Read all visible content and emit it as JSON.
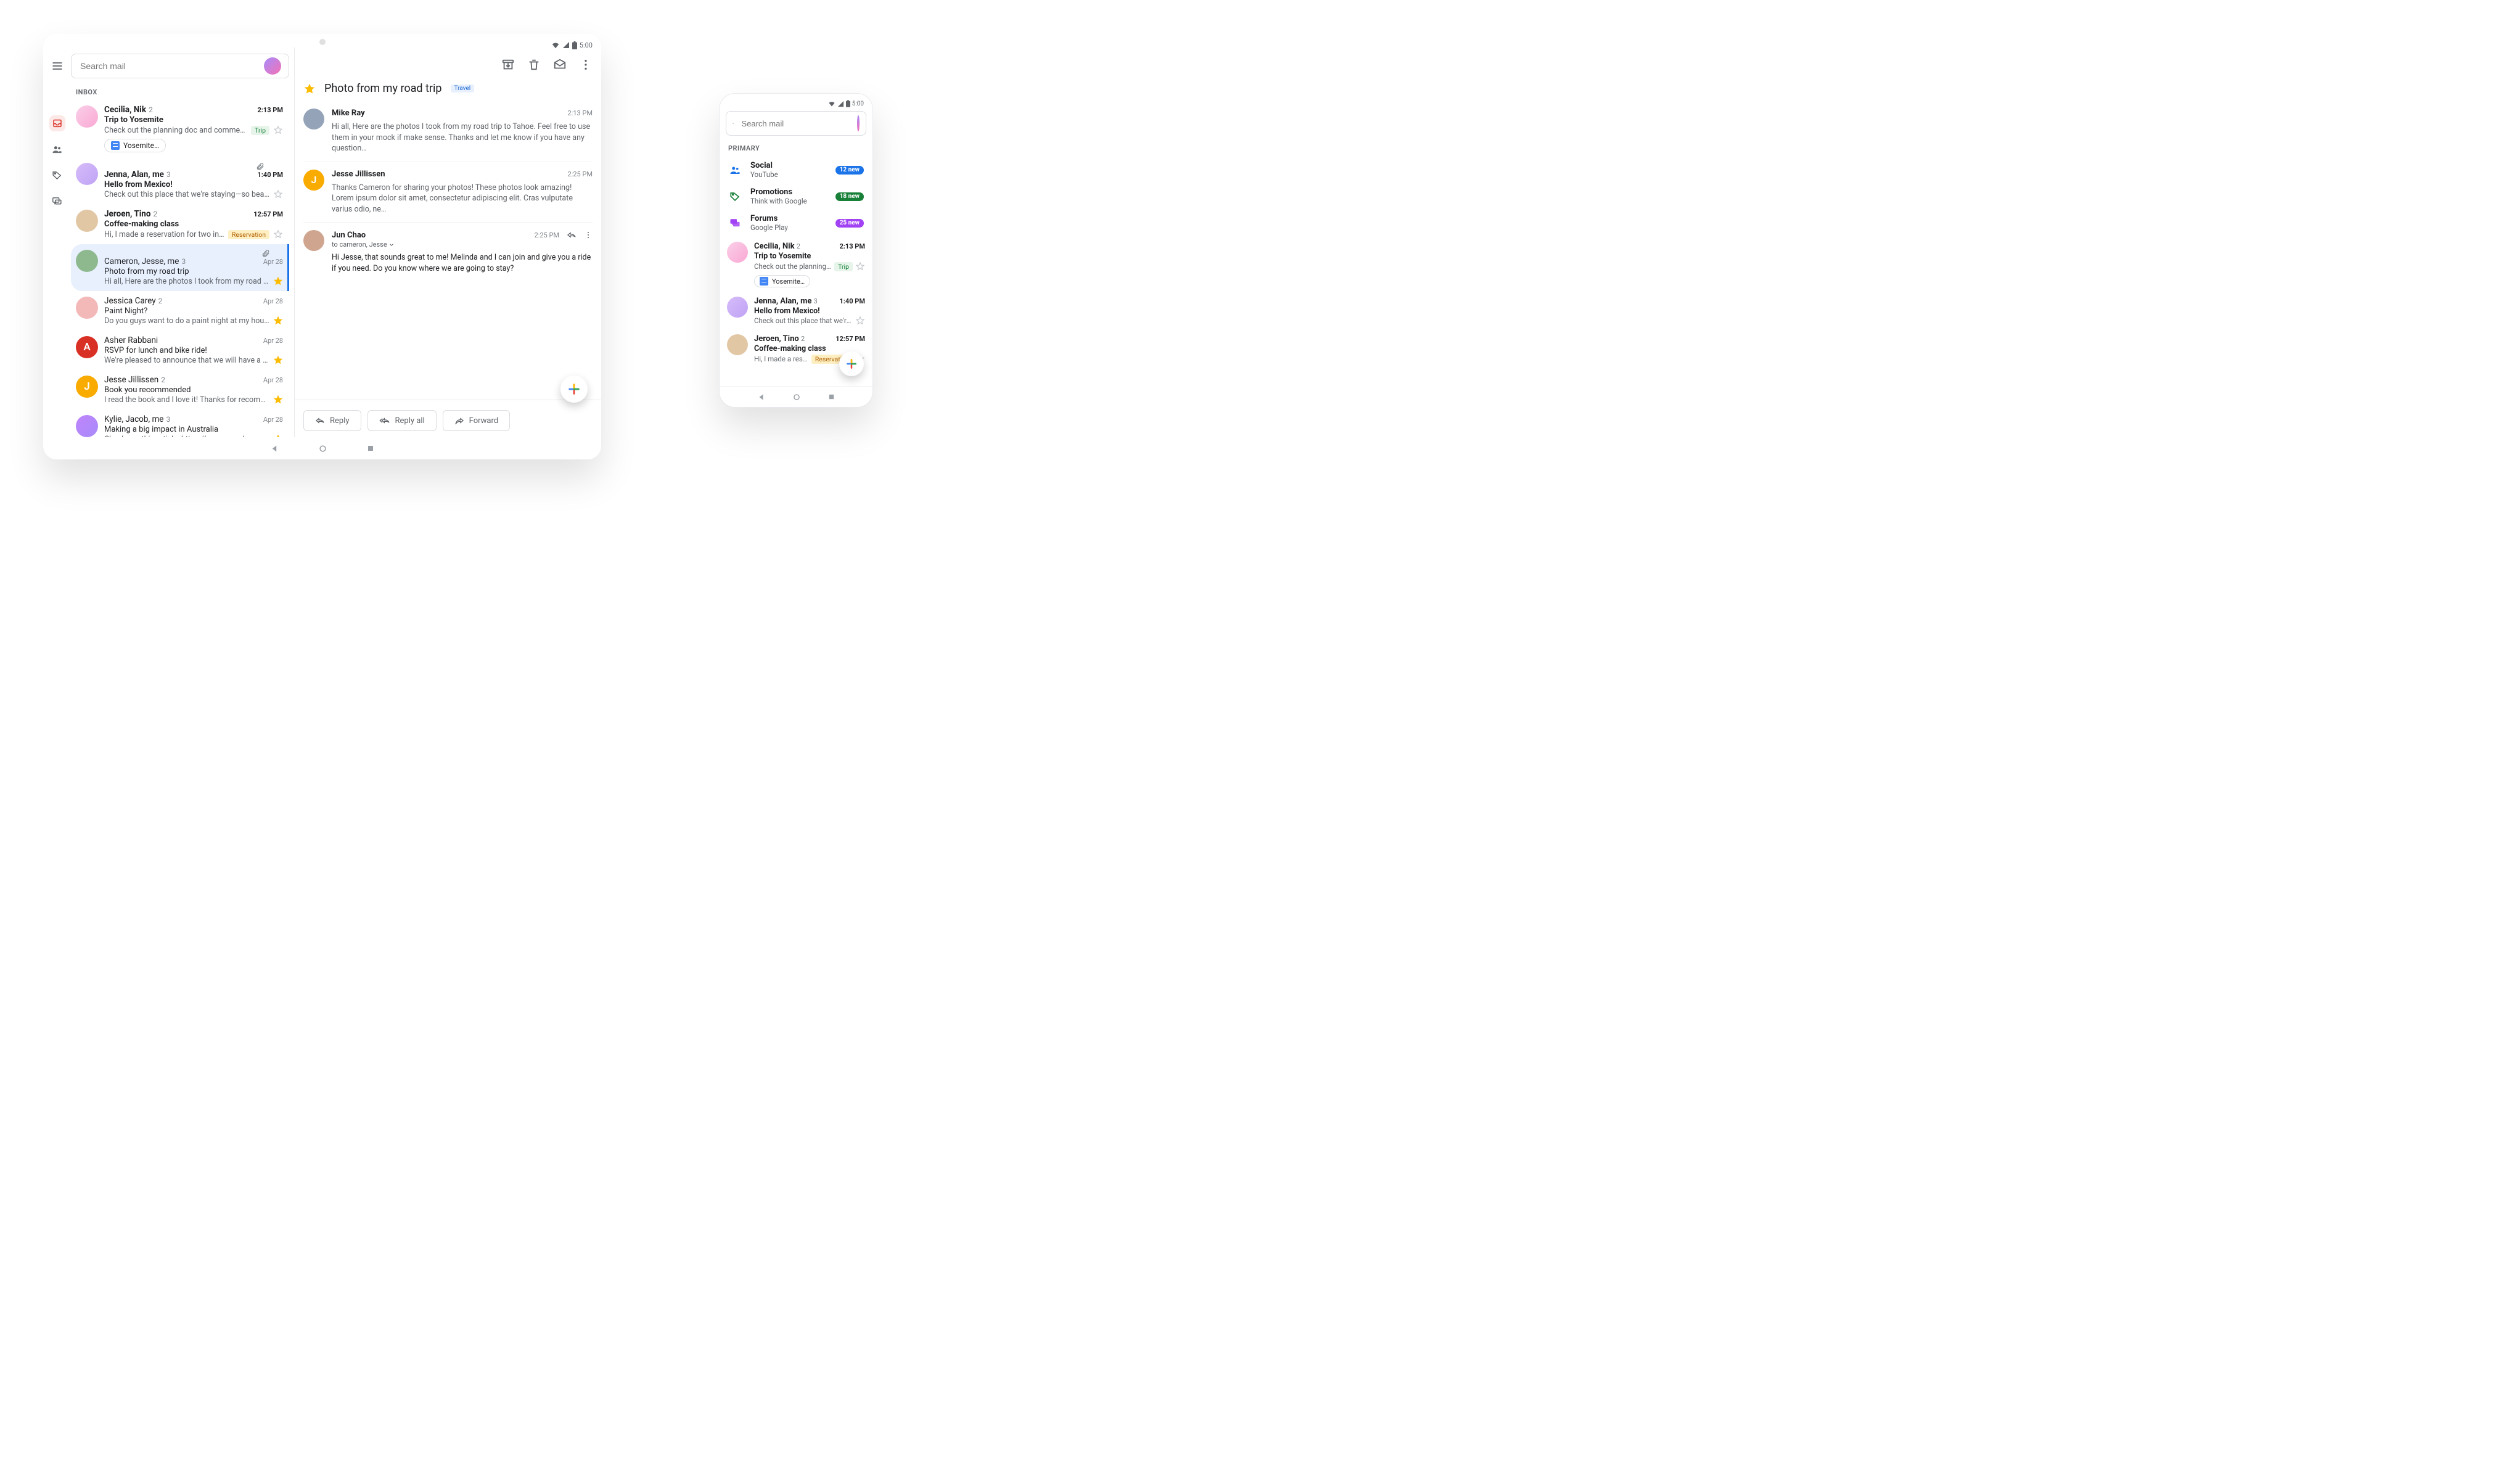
{
  "status": {
    "time": "5:00"
  },
  "search": {
    "placeholder": "Search mail"
  },
  "inbox_label": "INBOX",
  "compose_plus": "+",
  "threads": [
    {
      "id": 0,
      "senders": "Cecilia, Nik",
      "count": "2",
      "subject": "Trip to Yosemite",
      "snippet": "Check out the planning doc and comment on your…",
      "time": "2:13 PM",
      "starred": false,
      "unread": true,
      "label": "Trip",
      "chip": "Yosemite…",
      "avatar_bg": "linear-gradient(135deg,#fbcfe8,#f9a8d4)",
      "initial": ""
    },
    {
      "id": 1,
      "senders": "Jenna, Alan, me",
      "count": "3",
      "subject": "Hello from Mexico!",
      "snippet": "Check out this place that we're staying—so beautiful! We…",
      "time": "1:40 PM",
      "starred": false,
      "unread": true,
      "attach": true,
      "avatar_bg": "linear-gradient(135deg,#d6bcfa,#bfa3f5)",
      "initial": ""
    },
    {
      "id": 2,
      "senders": "Jeroen, Tino",
      "count": "2",
      "subject": "Coffee-making class",
      "snippet": "Hi, I made a reservation for two in downtown…",
      "time": "12:57 PM",
      "starred": false,
      "unread": true,
      "label": "Reservation",
      "label_style": "orange",
      "avatar_bg": "#e2c7a5",
      "initial": ""
    },
    {
      "id": 3,
      "senders": "Cameron, Jesse, me",
      "count": "3",
      "subject": "Photo from my road trip",
      "snippet": "Hi all, Here are the photos I took from my road trip to Ta…",
      "time": "Apr 28",
      "starred": true,
      "attach": true,
      "read": true,
      "selected": true,
      "avatar_bg": "#8eb98f",
      "initial": ""
    },
    {
      "id": 4,
      "senders": "Jessica Carey",
      "count": "2",
      "subject": "Paint Night?",
      "snippet": "Do you guys want to do a paint night at my house? I'm th…",
      "time": "Apr 28",
      "starred": true,
      "read": true,
      "avatar_bg": "#f3b8b8",
      "initial": ""
    },
    {
      "id": 5,
      "senders": "Asher Rabbani",
      "count": "",
      "subject": "RSVP for lunch and bike ride!",
      "snippet": "We're pleased to announce that we will have a new plan…",
      "time": "Apr 28",
      "starred": true,
      "read": true,
      "avatar_bg": "#d93025",
      "initial": "A"
    },
    {
      "id": 6,
      "senders": "Jesse Jillissen",
      "count": "2",
      "subject": "Book you recommended",
      "snippet": "I read the book and I love it! Thanks for recommending…",
      "time": "Apr 28",
      "starred": true,
      "read": true,
      "avatar_bg": "#f9ab00",
      "initial": "J"
    },
    {
      "id": 7,
      "senders": "Kylie, Jacob, me",
      "count": "3",
      "subject": "Making a big impact in Australia",
      "snippet": "Check you this article: https://www.google.com/austra…",
      "time": "Apr 28",
      "starred": true,
      "read": true,
      "avatar_bg": "linear-gradient(135deg,#c084fc,#a78bfa)",
      "initial": ""
    }
  ],
  "conversation": {
    "subject": "Photo from my road trip",
    "label": "Travel",
    "messages": [
      {
        "sender": "Mike Ray",
        "time": "2:13 PM",
        "text": "Hi all, Here are the photos I took from my road trip to Tahoe. Feel free to use them in your mock if make sense. Thanks and let me know if you have any question…",
        "avatar_bg": "#94a3b8",
        "initial": ""
      },
      {
        "sender": "Jesse Jillissen",
        "time": "2:25 PM",
        "text": "Thanks Cameron for sharing your photos! These photos look amazing! Lorem ipsum dolor sit amet, consectetur adipiscing elit. Cras vulputate varius odio, ne…",
        "avatar_bg": "#f9ab00",
        "initial": "J"
      },
      {
        "sender": "Jun Chao",
        "time": "2:25 PM",
        "to": "to cameron, Jesse",
        "text": "Hi Jesse, that sounds great to me! Melinda and I can join and give you a ride if you need. Do you know where we are going to stay?",
        "expanded": true,
        "avatar_bg": "#cfa58f",
        "initial": ""
      }
    ],
    "actions": {
      "reply": "Reply",
      "reply_all": "Reply all",
      "forward": "Forward"
    }
  },
  "phone": {
    "primary_label": "PRIMARY",
    "categories": [
      {
        "name": "Social",
        "sub": "YouTube",
        "badge": "12 new",
        "color": "blue",
        "icon": "people"
      },
      {
        "name": "Promotions",
        "sub": "Think with Google",
        "badge": "18 new",
        "color": "green",
        "icon": "tag"
      },
      {
        "name": "Forums",
        "sub": "Google Play",
        "badge": "25 new",
        "color": "purple",
        "icon": "forum"
      }
    ],
    "threads": [
      {
        "senders": "Cecilia, Nik",
        "count": "2",
        "subject": "Trip to Yosemite",
        "snippet": "Check out the planning doc…",
        "time": "2:13 PM",
        "label": "Trip",
        "chip": "Yosemite…",
        "unread": true,
        "avatar_bg": "linear-gradient(135deg,#fbcfe8,#f9a8d4)"
      },
      {
        "senders": "Jenna, Alan, me",
        "count": "3",
        "subject": "Hello from Mexico!",
        "snippet": "Check out this place that we're st…",
        "time": "1:40 PM",
        "unread": true,
        "avatar_bg": "linear-gradient(135deg,#d6bcfa,#bfa3f5)"
      },
      {
        "senders": "Jeroen, Tino",
        "count": "2",
        "subject": "Coffee-making class",
        "snippet": "Hi, I made a reservati…",
        "time": "12:57 PM",
        "label": "Reservation",
        "label_style": "orange",
        "unread": true,
        "avatar_bg": "#e2c7a5"
      }
    ]
  }
}
